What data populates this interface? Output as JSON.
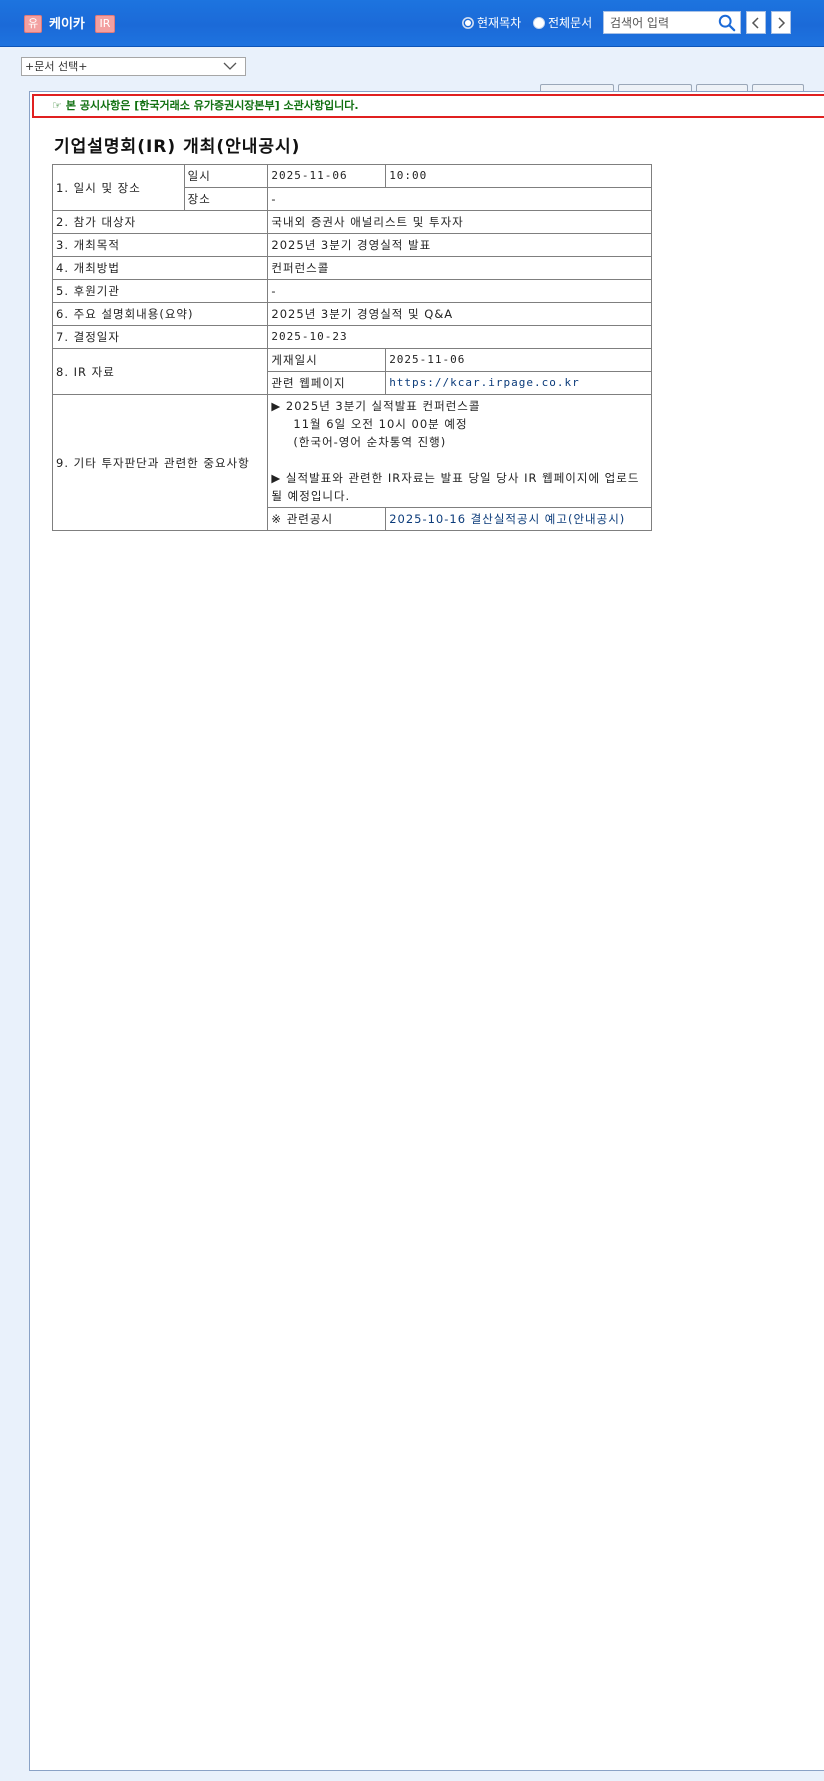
{
  "header": {
    "badge_left": "유",
    "company": "케이카",
    "badge_right": "IR",
    "radio_current": "현재목차",
    "radio_all": "전체문서",
    "search_placeholder": "검색어 입력"
  },
  "doc_select": {
    "value": "+문서 선택+"
  },
  "notice": "본 공시사항은 [한국거래소 유가증권시장본부] 소관사항입니다.",
  "doc_title": "기업설명회(IR) 개최(안내공시)",
  "table": {
    "r1_label": "1. 일시 및 장소",
    "r1_sub1": "일시",
    "r1_date": "2025-11-06",
    "r1_time": "10:00",
    "r1_sub2": "장소",
    "r1_place": "-",
    "r2_label": "2. 참가 대상자",
    "r2_value": "국내외 증권사 애널리스트 및 투자자",
    "r3_label": "3. 개최목적",
    "r3_value": "2025년 3분기 경영실적 발표",
    "r4_label": "4. 개최방법",
    "r4_value": "컨퍼런스콜",
    "r5_label": "5. 후원기관",
    "r5_value": "-",
    "r6_label": "6. 주요 설명회내용(요약)",
    "r6_value": "2025년 3분기 경영실적 및 Q&A",
    "r7_label": "7. 결정일자",
    "r7_value": "2025-10-23",
    "r8_label": "8. IR 자료",
    "r8_sub1": "게재일시",
    "r8_date": "2025-11-06",
    "r8_sub2": "관련 웹페이지",
    "r8_url": "https://kcar.irpage.co.kr",
    "r9_label": "9. 기타 투자판단과 관련한 중요사항",
    "r9_line1": "▶ 2025년 3분기 실적발표 컨퍼런스콜",
    "r9_line2": "11월 6일 오전 10시 00분 예정",
    "r9_line3": "(한국어-영어 순차통역 진행)",
    "r9_line4": "▶ 실적발표와 관련한 IR자료는 발표 당일 당사 IR 웹페이지에 업로드 될 예정입니다.",
    "r9_sub": "※ 관련공시",
    "r9_related": "2025-10-16 결산실적공시 예고(안내공시)"
  },
  "colors": {
    "header_blue": "#1b6ad8",
    "notice_red": "#e02020",
    "notice_green": "#107010",
    "link": "#0b3b7a"
  }
}
